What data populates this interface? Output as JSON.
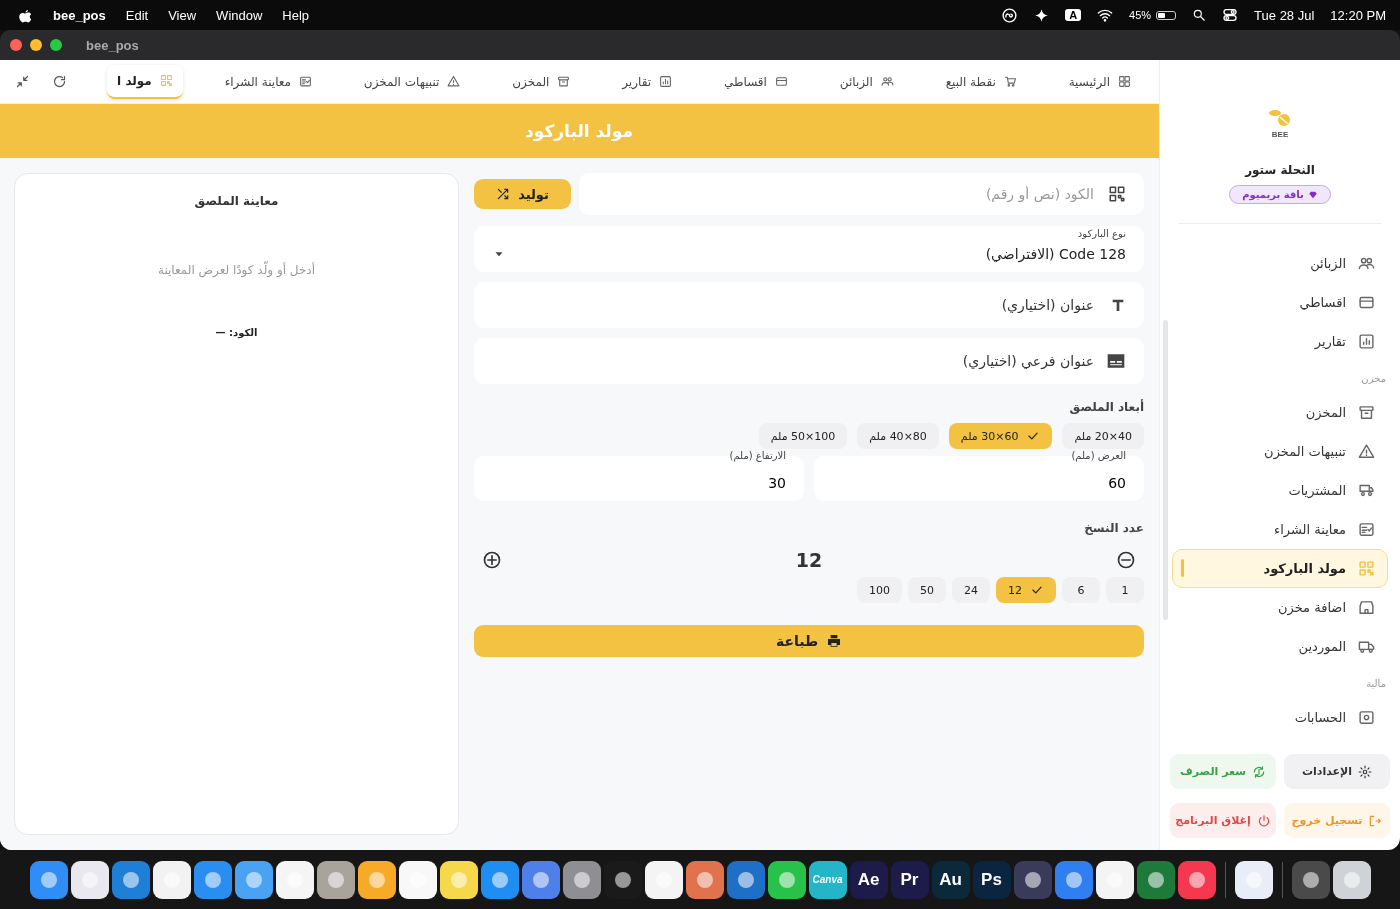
{
  "menubar": {
    "app": "bee_pos",
    "menus": [
      "Help",
      "Window",
      "View",
      "Edit"
    ],
    "input_source": "A",
    "battery": "45%",
    "date": "Tue 28 Jul",
    "time": "12:20 PM"
  },
  "window": {
    "title": "bee_pos"
  },
  "tabs": [
    {
      "label": "الرئيسية",
      "selected": false
    },
    {
      "label": "نقطة البيع",
      "selected": false
    },
    {
      "label": "الزبائن",
      "selected": false
    },
    {
      "label": "اقساطي",
      "selected": false
    },
    {
      "label": "تقارير",
      "selected": false
    },
    {
      "label": "المخزن",
      "selected": false
    },
    {
      "label": "تنبيهات المخزن",
      "selected": false
    },
    {
      "label": "معاينة الشراء",
      "selected": false
    },
    {
      "label": "مولد ا",
      "selected": true
    }
  ],
  "header": {
    "title": "مولد الباركود"
  },
  "form": {
    "code": {
      "placeholder": "الكود (نص أو رقم)"
    },
    "generate_button": "توليد",
    "barcode_type": {
      "label": "نوع الباركود",
      "value": "Code 128 (الافتراضي)"
    },
    "title_field": {
      "placeholder": "عنوان (اختياري)"
    },
    "subtitle_field": {
      "placeholder": "عنوان فرعي (اختياري)"
    },
    "size_heading": "أبعاد الملصق",
    "sizes": [
      {
        "label": "40×20 ملم",
        "selected": false
      },
      {
        "label": "60×30 ملم",
        "selected": true
      },
      {
        "label": "80×40 ملم",
        "selected": false
      },
      {
        "label": "100×50 ملم",
        "selected": false
      }
    ],
    "width": {
      "label": "العرض (ملم)",
      "value": "60"
    },
    "height": {
      "label": "الارتفاع (ملم)",
      "value": "30"
    },
    "copies_heading": "عدد النسخ",
    "copies": "12",
    "copy_presets": [
      {
        "label": "1",
        "selected": false
      },
      {
        "label": "6",
        "selected": false
      },
      {
        "label": "12",
        "selected": true
      },
      {
        "label": "24",
        "selected": false
      },
      {
        "label": "50",
        "selected": false
      },
      {
        "label": "100",
        "selected": false
      }
    ],
    "print_button": "طباعة"
  },
  "preview": {
    "title": "معاينة الملصق",
    "hint": "أدخل أو ولّد كودًا لعرض المعاينة",
    "code_label": "الكود: —"
  },
  "sidebar": {
    "logo_text": "BEE",
    "store": "النحلة ستور",
    "plan": "باقة بريميوم",
    "items": [
      {
        "kind": "item",
        "label": "الزبائن",
        "selected": false
      },
      {
        "kind": "item",
        "label": "اقساطي",
        "selected": false
      },
      {
        "kind": "item",
        "label": "تقارير",
        "selected": false
      },
      {
        "kind": "section",
        "label": "مخزن"
      },
      {
        "kind": "item",
        "label": "المخزن",
        "selected": false
      },
      {
        "kind": "item",
        "label": "تنبيهات المخزن",
        "selected": false
      },
      {
        "kind": "item",
        "label": "المشتريات",
        "selected": false
      },
      {
        "kind": "item",
        "label": "معاينة الشراء",
        "selected": false
      },
      {
        "kind": "item",
        "label": "مولد الباركود",
        "selected": true
      },
      {
        "kind": "item",
        "label": "اضافة مخزن",
        "selected": false
      },
      {
        "kind": "item",
        "label": "الموردين",
        "selected": false
      },
      {
        "kind": "section",
        "label": "مالية"
      },
      {
        "kind": "item",
        "label": "الحسابات",
        "selected": false
      }
    ],
    "actions": [
      {
        "kind": "settings",
        "label": "الإعدادات"
      },
      {
        "kind": "exchange",
        "label": "سعر الصرف"
      },
      {
        "kind": "logout",
        "label": "تسجيل خروج"
      },
      {
        "kind": "quit",
        "label": "إغلاق البرنامج"
      }
    ]
  },
  "dock": [
    {
      "color": "#cfd2d6"
    },
    {
      "color": "#4a4a4a"
    },
    {
      "color": "#e8edf7"
    },
    {
      "color": "#f5384f"
    },
    {
      "color": "#1d7a3a"
    },
    {
      "color": "#f4f4f4"
    },
    {
      "color": "#2f7ff0"
    },
    {
      "color": "#3a3a5a"
    },
    {
      "color": "#0b2540",
      "label": "Ps"
    },
    {
      "color": "#0a2a3a",
      "label": "Au"
    },
    {
      "color": "#1d1b4a",
      "label": "Pr"
    },
    {
      "color": "#1d1b4a",
      "label": "Ae"
    },
    {
      "color": "#24b5c9",
      "label": "Canva"
    },
    {
      "color": "#28c24a"
    },
    {
      "color": "#1f6fc6"
    },
    {
      "color": "#e0724e"
    },
    {
      "color": "#f4f4f4"
    },
    {
      "color": "#1a1a1a"
    },
    {
      "color": "#8e8e93"
    },
    {
      "color": "#4f7fe8"
    },
    {
      "color": "#1e8ef2"
    },
    {
      "color": "#f6d94a"
    },
    {
      "color": "#f8f8f8"
    },
    {
      "color": "#f7a928"
    },
    {
      "color": "#a8a49c"
    },
    {
      "color": "#f5f5f5"
    },
    {
      "color": "#4aa3f2"
    },
    {
      "color": "#2a8ef0"
    },
    {
      "color": "#f2f2f2"
    },
    {
      "color": "#1f7fd6"
    },
    {
      "color": "#e8e8ee"
    },
    {
      "color": "#2f8df5"
    }
  ]
}
